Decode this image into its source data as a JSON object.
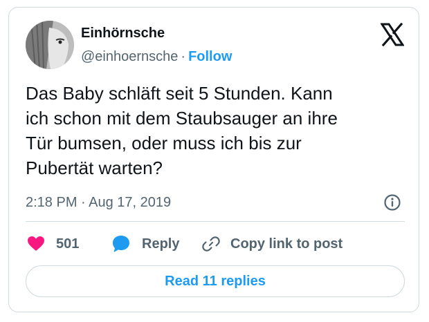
{
  "author": {
    "name": "Einhörnsche",
    "handle": "@einhoernsche",
    "separator": "·",
    "follow_label": "Follow"
  },
  "tweet": {
    "text": "Das Baby schläft seit 5 Stunden. Kann\nich schon mit dem Staubsauger an ihre\nTür bumsen, oder muss ich bis zur\nPubertät warten?",
    "timestamp": "2:18 PM · Aug 17, 2019"
  },
  "actions": {
    "like_count": "501",
    "reply_label": "Reply",
    "copy_label": "Copy link to post"
  },
  "footer": {
    "read_replies_label": "Read 11 replies"
  },
  "colors": {
    "accent": "#1d9bf0",
    "like": "#f91880",
    "muted": "#536471",
    "border": "#cfd9de"
  },
  "icons": [
    "x-logo-icon",
    "info-icon",
    "heart-icon",
    "reply-bubble-icon",
    "link-icon"
  ]
}
